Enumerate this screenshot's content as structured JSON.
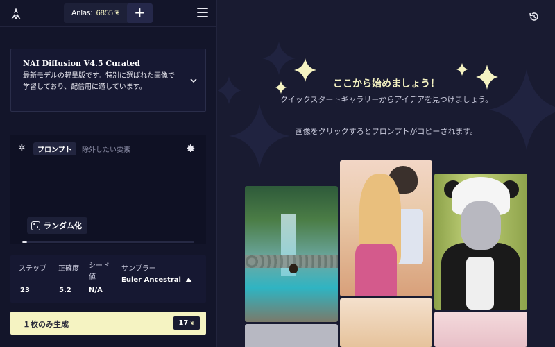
{
  "header": {
    "anlas_label": "Anlas:",
    "anlas_value": "6855",
    "plus_label": "+"
  },
  "model": {
    "title": "NAI Diffusion V4.5 Curated",
    "description": "最新モデルの軽量版です。特別に選ばれた画像で学習しており、配信用に適しています。"
  },
  "prompt": {
    "tab_prompt": "プロンプト",
    "tab_negative": "除外したい要素",
    "random_label": "ランダム化",
    "progress": 0.03
  },
  "settings": {
    "steps_label": "ステップ",
    "steps_value": "23",
    "guidance_label": "正確度",
    "guidance_value": "5.2",
    "seed_label": "シード値",
    "seed_value": "N/A",
    "sampler_label": "サンプラー",
    "sampler_value": "Euler Ancestral"
  },
  "generate": {
    "label": "１枚のみ生成",
    "cost": "17"
  },
  "hero": {
    "title": "ここから始めましょう！",
    "subtitle": "クイックスタートギャラリーからアイデアを見つけましょう。",
    "hint": "画像をクリックするとプロンプトがコピーされます。"
  },
  "colors": {
    "accent": "#f5f3c2",
    "background": "#191b31",
    "sidebar": "#13152a"
  },
  "icons": [
    "logo-icon",
    "anlas-leaf-icon",
    "plus-icon",
    "menu-icon",
    "chevron-down-icon",
    "sparkle-icon",
    "gear-icon",
    "dice-icon",
    "triangle-up-icon",
    "history-icon"
  ]
}
